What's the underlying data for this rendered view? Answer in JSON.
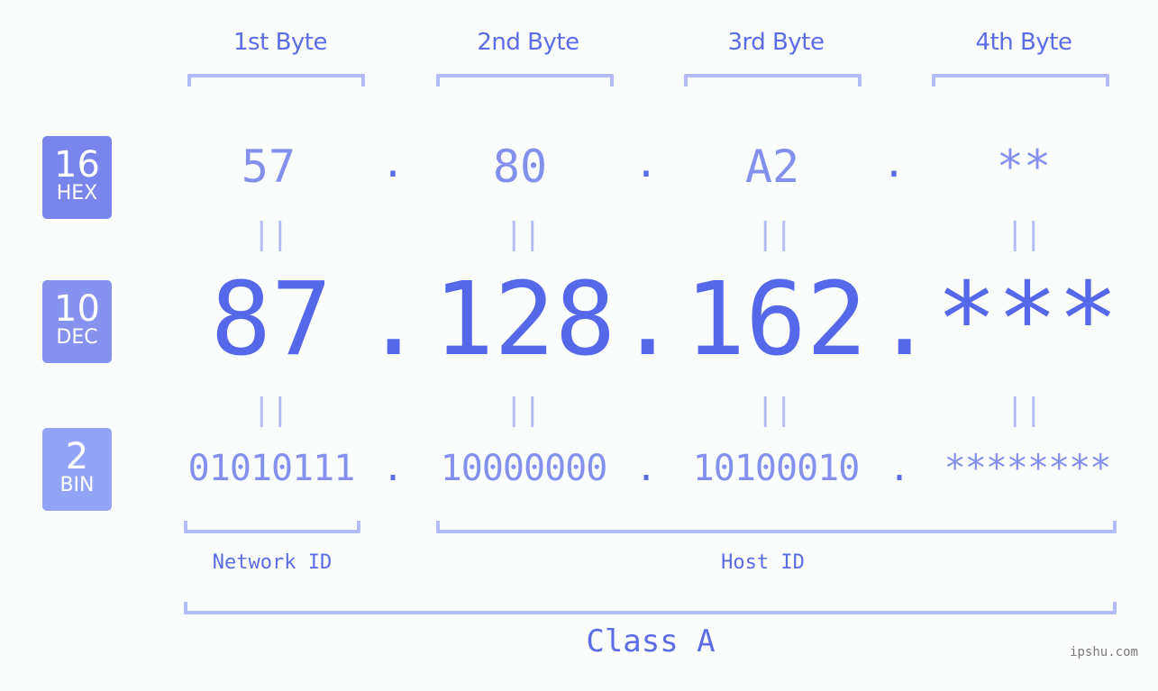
{
  "byte_headers": [
    "1st Byte",
    "2nd Byte",
    "3rd Byte",
    "4th Byte"
  ],
  "badges": {
    "hex": {
      "number": "16",
      "label": "HEX",
      "color": "#7885ec"
    },
    "dec": {
      "number": "10",
      "label": "DEC",
      "color": "#8592f0"
    },
    "bin": {
      "number": "2",
      "label": "BIN",
      "color": "#91a4f8"
    }
  },
  "hex": {
    "bytes": [
      "57",
      "80",
      "A2",
      "**"
    ],
    "separator": "."
  },
  "dec": {
    "bytes": [
      "87",
      "128",
      "162",
      "***"
    ],
    "separator": "."
  },
  "bin": {
    "bytes": [
      "01010111",
      "10000000",
      "10100010",
      "********"
    ],
    "separator": "."
  },
  "equals_symbol": "||",
  "network_id_label": "Network ID",
  "host_id_label": "Host ID",
  "class_label": "Class A",
  "watermark": "ipshu.com",
  "colors": {
    "primary": "#5568ea",
    "secondary": "#8390ee",
    "bracket": "#b3bcf6",
    "background": "#fbfcfc"
  }
}
